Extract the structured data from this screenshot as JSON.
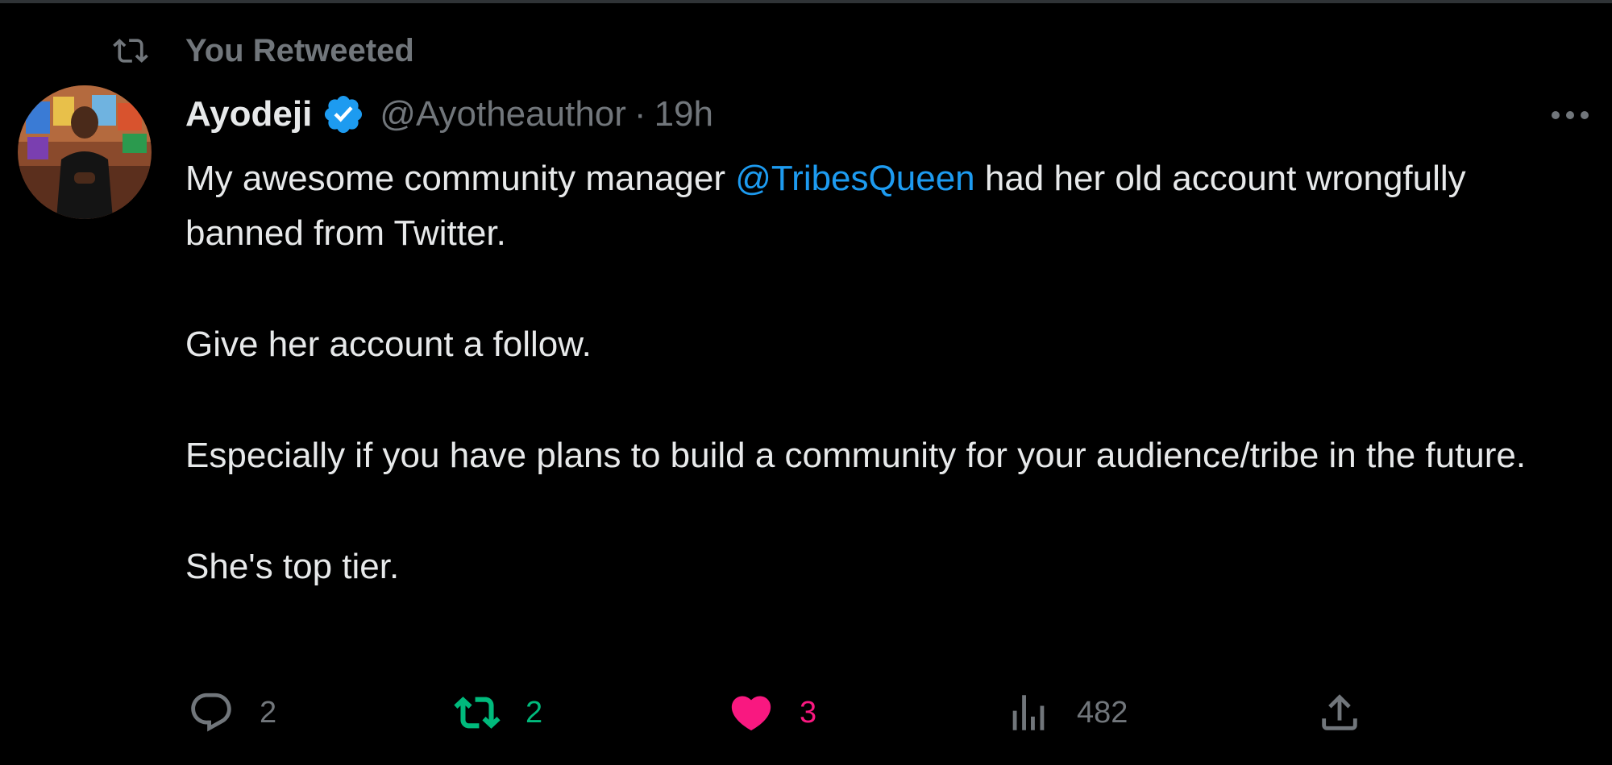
{
  "retweet_context": {
    "label": "You Retweeted"
  },
  "author": {
    "display_name": "Ayodeji",
    "handle": "@Ayotheauthor",
    "separator": "·",
    "time": "19h"
  },
  "tweet": {
    "line1_before": "My awesome community manager ",
    "mention": "@TribesQueen",
    "line1_after": " had her old account wrongfully banned from Twitter.",
    "paragraph2": "Give her account a follow.",
    "paragraph3": "Especially if you have plans to build a community for your audience/tribe in the future.",
    "paragraph4": "She's top tier."
  },
  "actions": {
    "replies": "2",
    "retweets": "2",
    "likes": "3",
    "views": "482"
  },
  "colors": {
    "background": "#000000",
    "text": "#e7e9ea",
    "muted": "#71767b",
    "link": "#1d9bf0",
    "retweet_active": "#00ba7c",
    "like_active": "#f91880"
  },
  "icons": {
    "retweet_context": "retweet-icon",
    "verified": "verified-badge-icon",
    "more": "more-icon",
    "reply": "reply-icon",
    "retweet": "retweet-icon",
    "like": "heart-icon",
    "views": "views-icon",
    "share": "share-icon"
  }
}
